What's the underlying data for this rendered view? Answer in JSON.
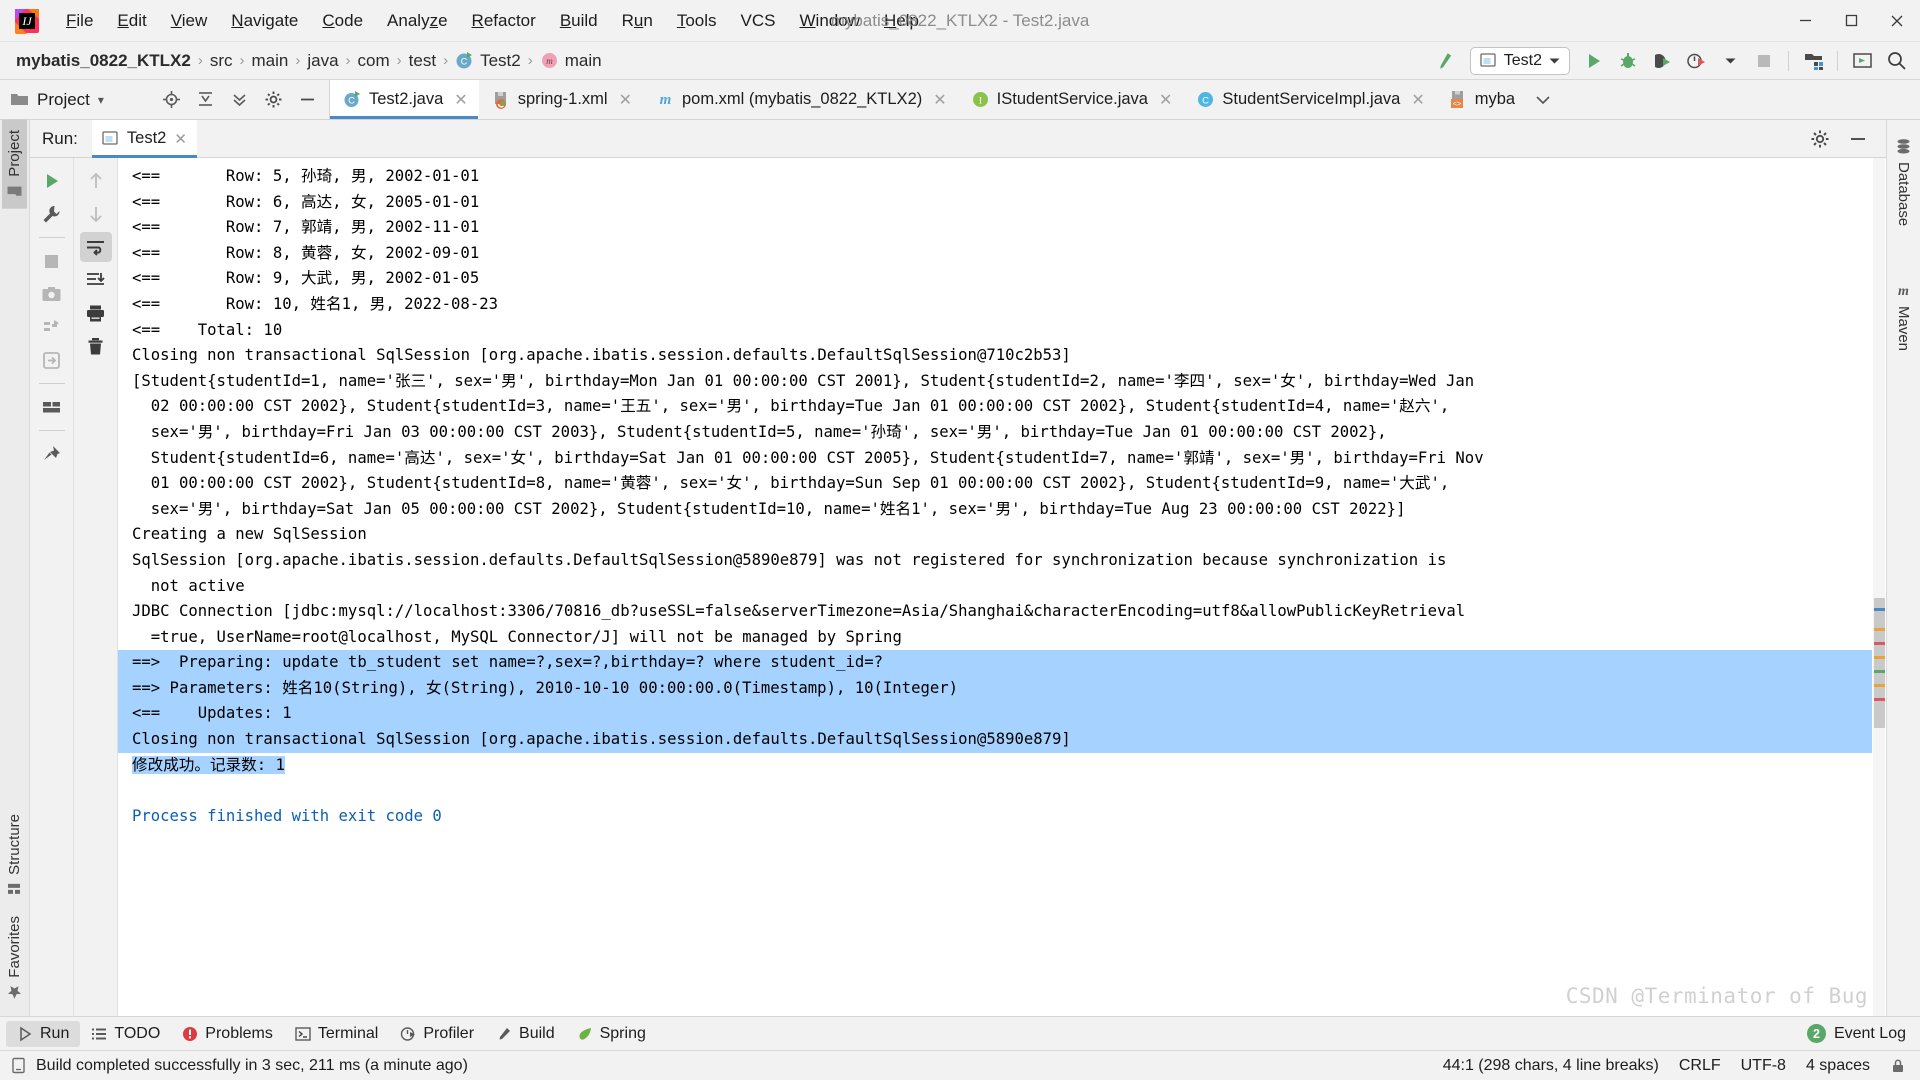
{
  "titlebar": {
    "window_title": "mybatis_0822_KTLX2 - Test2.java",
    "menus": [
      "File",
      "Edit",
      "View",
      "Navigate",
      "Code",
      "Analyze",
      "Refactor",
      "Build",
      "Run",
      "Tools",
      "VCS",
      "Window",
      "Help"
    ],
    "minimize": "─",
    "maximize": "❐",
    "close": "✕"
  },
  "navbar": {
    "breadcrumbs": [
      {
        "label": "mybatis_0822_KTLX2",
        "icon": "none"
      },
      {
        "label": "src",
        "icon": "none"
      },
      {
        "label": "main",
        "icon": "none"
      },
      {
        "label": "java",
        "icon": "none"
      },
      {
        "label": "com",
        "icon": "none"
      },
      {
        "label": "test",
        "icon": "none"
      },
      {
        "label": "Test2",
        "icon": "class-icon"
      },
      {
        "label": "main",
        "icon": "method-icon"
      }
    ],
    "separator": "›",
    "run_config": "Test2",
    "dropdown_caret": "▼",
    "buttons": [
      "build-hammer-icon",
      "run-icon",
      "debug-icon",
      "run-coverage-icon",
      "profiler-icon",
      "stop-icon",
      "project-structure-icon",
      "restore-layout-icon",
      "search-everywhere-icon"
    ]
  },
  "project_panel": {
    "title": "Project",
    "caret": "▾",
    "tools": [
      "locate-icon",
      "collapse-all-icon",
      "expand-icon",
      "settings-gear-icon",
      "hide-icon"
    ]
  },
  "editor_tabs": [
    {
      "label": "Test2.java",
      "icon": "java-class-run-icon",
      "active": true,
      "close": "✕"
    },
    {
      "label": "spring-1.xml",
      "icon": "spring-xml-icon",
      "active": false,
      "close": "✕"
    },
    {
      "label": "pom.xml (mybatis_0822_KTLX2)",
      "icon": "maven-icon",
      "active": false,
      "close": "✕"
    },
    {
      "label": "IStudentService.java",
      "icon": "java-interface-icon",
      "active": false,
      "close": "✕"
    },
    {
      "label": "StudentServiceImpl.java",
      "icon": "java-class-icon",
      "active": false,
      "close": "✕"
    },
    {
      "label": "myba",
      "icon": "xml-icon",
      "active": false,
      "close": ""
    }
  ],
  "tabs_overflow_caret": "∨",
  "left_strip": {
    "top_tab": "Project",
    "bottom_tabs": [
      "Structure",
      "Favorites"
    ]
  },
  "right_strip": {
    "tabs": [
      "Database",
      "Maven"
    ]
  },
  "run_window": {
    "label": "Run:",
    "tab": "Test2",
    "tab_close": "✕",
    "settings_icon": "gear-icon",
    "hide_icon": "minimize-icon",
    "left_tools": [
      "rerun-icon",
      "settings-wrench-icon",
      "stop-icon",
      "screenshot-icon",
      "thread-dump-icon",
      "export-icon",
      "layout-icon",
      "pin-icon"
    ],
    "right_tools": [
      "up-arrow-icon",
      "down-arrow-icon",
      "soft-wrap-icon",
      "scroll-to-end-icon",
      "print-icon",
      "trash-icon"
    ]
  },
  "console": {
    "lines": [
      {
        "text": "<==       Row: 5, 孙琦, 男, 2002-01-01",
        "style": "plain"
      },
      {
        "text": "<==       Row: 6, 高达, 女, 2005-01-01",
        "style": "plain"
      },
      {
        "text": "<==       Row: 7, 郭靖, 男, 2002-11-01",
        "style": "plain"
      },
      {
        "text": "<==       Row: 8, 黄蓉, 女, 2002-09-01",
        "style": "plain"
      },
      {
        "text": "<==       Row: 9, 大武, 男, 2002-01-05",
        "style": "plain"
      },
      {
        "text": "<==       Row: 10, 姓名1, 男, 2022-08-23",
        "style": "plain"
      },
      {
        "text": "<==    Total: 10",
        "style": "plain"
      },
      {
        "text": "Closing non transactional SqlSession [org.apache.ibatis.session.defaults.DefaultSqlSession@710c2b53]",
        "style": "plain"
      },
      {
        "text": "[Student{studentId=1, name='张三', sex='男', birthday=Mon Jan 01 00:00:00 CST 2001}, Student{studentId=2, name='李四', sex='女', birthday=Wed Jan",
        "style": "plain"
      },
      {
        "text": "  02 00:00:00 CST 2002}, Student{studentId=3, name='王五', sex='男', birthday=Tue Jan 01 00:00:00 CST 2002}, Student{studentId=4, name='赵六',",
        "style": "plain"
      },
      {
        "text": "  sex='男', birthday=Fri Jan 03 00:00:00 CST 2003}, Student{studentId=5, name='孙琦', sex='男', birthday=Tue Jan 01 00:00:00 CST 2002},",
        "style": "plain"
      },
      {
        "text": "  Student{studentId=6, name='高达', sex='女', birthday=Sat Jan 01 00:00:00 CST 2005}, Student{studentId=7, name='郭靖', sex='男', birthday=Fri Nov",
        "style": "plain"
      },
      {
        "text": "  01 00:00:00 CST 2002}, Student{studentId=8, name='黄蓉', sex='女', birthday=Sun Sep 01 00:00:00 CST 2002}, Student{studentId=9, name='大武',",
        "style": "plain"
      },
      {
        "text": "  sex='男', birthday=Sat Jan 05 00:00:00 CST 2002}, Student{studentId=10, name='姓名1', sex='男', birthday=Tue Aug 23 00:00:00 CST 2022}]",
        "style": "plain"
      },
      {
        "text": "Creating a new SqlSession",
        "style": "plain"
      },
      {
        "text": "SqlSession [org.apache.ibatis.session.defaults.DefaultSqlSession@5890e879] was not registered for synchronization because synchronization is",
        "style": "plain"
      },
      {
        "text": "  not active",
        "style": "plain"
      },
      {
        "text": "JDBC Connection [jdbc:mysql://localhost:3306/70816_db?useSSL=false&serverTimezone=Asia/Shanghai&characterEncoding=utf8&allowPublicKeyRetrieval",
        "style": "plain"
      },
      {
        "text": "  =true, UserName=root@localhost, MySQL Connector/J] will not be managed by Spring",
        "style": "plain"
      },
      {
        "text": "==>  Preparing: update tb_student set name=?,sex=?,birthday=? where student_id=?",
        "style": "selected"
      },
      {
        "text": "==> Parameters: 姓名10(String), 女(String), 2010-10-10 00:00:00.0(Timestamp), 10(Integer)",
        "style": "selected"
      },
      {
        "text": "<==    Updates: 1",
        "style": "selected"
      },
      {
        "text": "Closing non transactional SqlSession [org.apache.ibatis.session.defaults.DefaultSqlSession@5890e879]",
        "style": "selected"
      },
      {
        "text": "修改成功。记录数: 1",
        "style": "selected-partial"
      },
      {
        "text": "",
        "style": "plain"
      },
      {
        "text": "Process finished with exit code 0",
        "style": "blue"
      }
    ],
    "watermark": "CSDN @Terminator of Bug"
  },
  "bottom_strip": {
    "tabs": [
      {
        "label": "Run",
        "icon": "run-icon",
        "active": true
      },
      {
        "label": "TODO",
        "icon": "todo-icon",
        "active": false
      },
      {
        "label": "Problems",
        "icon": "problems-icon",
        "active": false
      },
      {
        "label": "Terminal",
        "icon": "terminal-icon",
        "active": false
      },
      {
        "label": "Profiler",
        "icon": "profiler-icon",
        "active": false
      },
      {
        "label": "Build",
        "icon": "build-hammer-icon",
        "active": false
      },
      {
        "label": "Spring",
        "icon": "spring-leaf-icon",
        "active": false
      }
    ],
    "event_log": {
      "label": "Event Log",
      "count": "2"
    }
  },
  "statusbar": {
    "message": "Build completed successfully in 3 sec, 211 ms (a minute ago)",
    "caret_position": "44:1 (298 chars, 4 line breaks)",
    "line_separator": "CRLF",
    "encoding": "UTF-8",
    "indent": "4 spaces",
    "message_icon": "console-icon",
    "lock_icon": "lock-icon"
  },
  "colors": {
    "accent_blue": "#4a88c7",
    "selection_blue": "#a6d2ff",
    "green": "#59a869",
    "link_blue": "#0b5fb5",
    "panel_bg": "#f2f2f2",
    "editor_bg": "#ffffff"
  }
}
